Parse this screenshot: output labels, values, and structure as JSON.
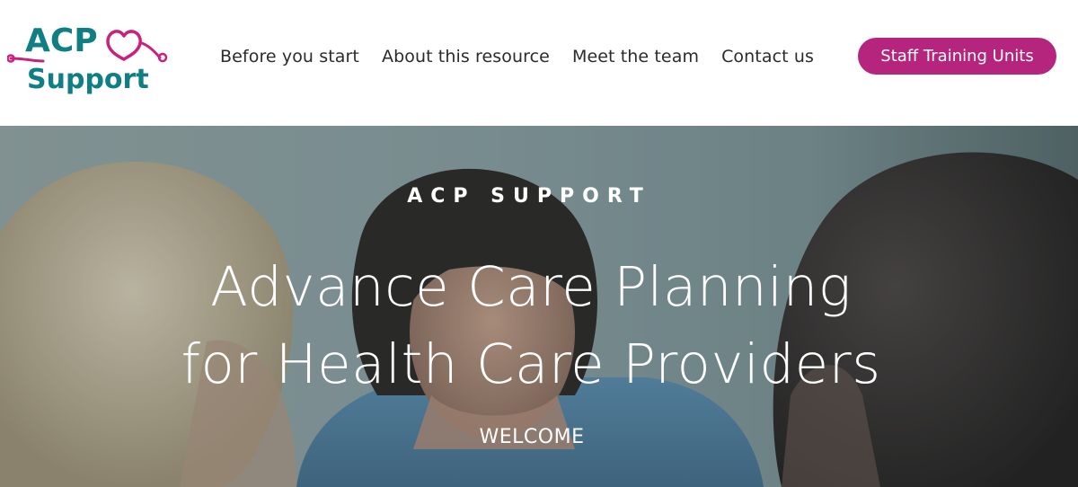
{
  "logo": {
    "line1": "ACP",
    "line2": "Support",
    "colors": {
      "teal": "#0f7f84",
      "magenta": "#c8217e"
    }
  },
  "nav": {
    "links": [
      {
        "label": "Before you start"
      },
      {
        "label": "About this resource"
      },
      {
        "label": "Meet the team"
      },
      {
        "label": "Contact us"
      }
    ],
    "cta_label": "Staff Training Units",
    "cta_color": "#b5257e"
  },
  "hero": {
    "eyebrow": "ACP SUPPORT",
    "title_line1": "Advance Care Planning",
    "title_line2": "for Health Care Providers",
    "welcome": "WELCOME",
    "image_description_icon": "photo-nurse-consultation"
  }
}
